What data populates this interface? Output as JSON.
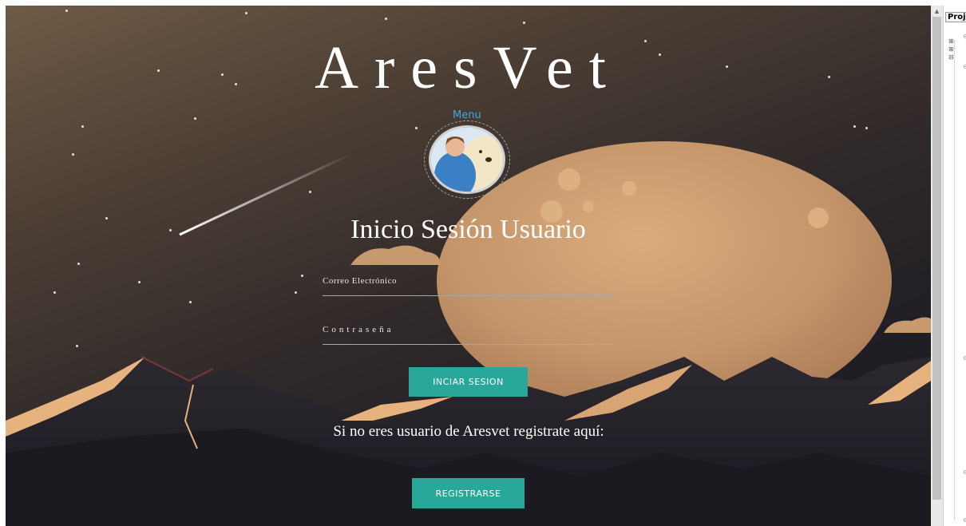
{
  "page": {
    "app_title": "AresVet",
    "menu_link": "Menu",
    "login_heading": "Inicio Sesión Usuario",
    "email_placeholder": "Correo Electrónico",
    "password_placeholder": "Contraseña",
    "login_button": "INCIAR SESION",
    "register_prompt": "Si no eres usuario de Aresvet registrate aquí:",
    "register_button": "REGISTRARSE"
  },
  "side_panel": {
    "tab_label": "Proj"
  },
  "colors": {
    "accent_button": "#29a89a",
    "menu_link": "#3fa9e0",
    "moon": "#c99a6b",
    "night_sky": "#1e1d24"
  },
  "icons": [
    "vet-avatar-image",
    "shooting-star",
    "moon",
    "mountains",
    "scroll-up-arrow",
    "tree-expand-icon"
  ]
}
